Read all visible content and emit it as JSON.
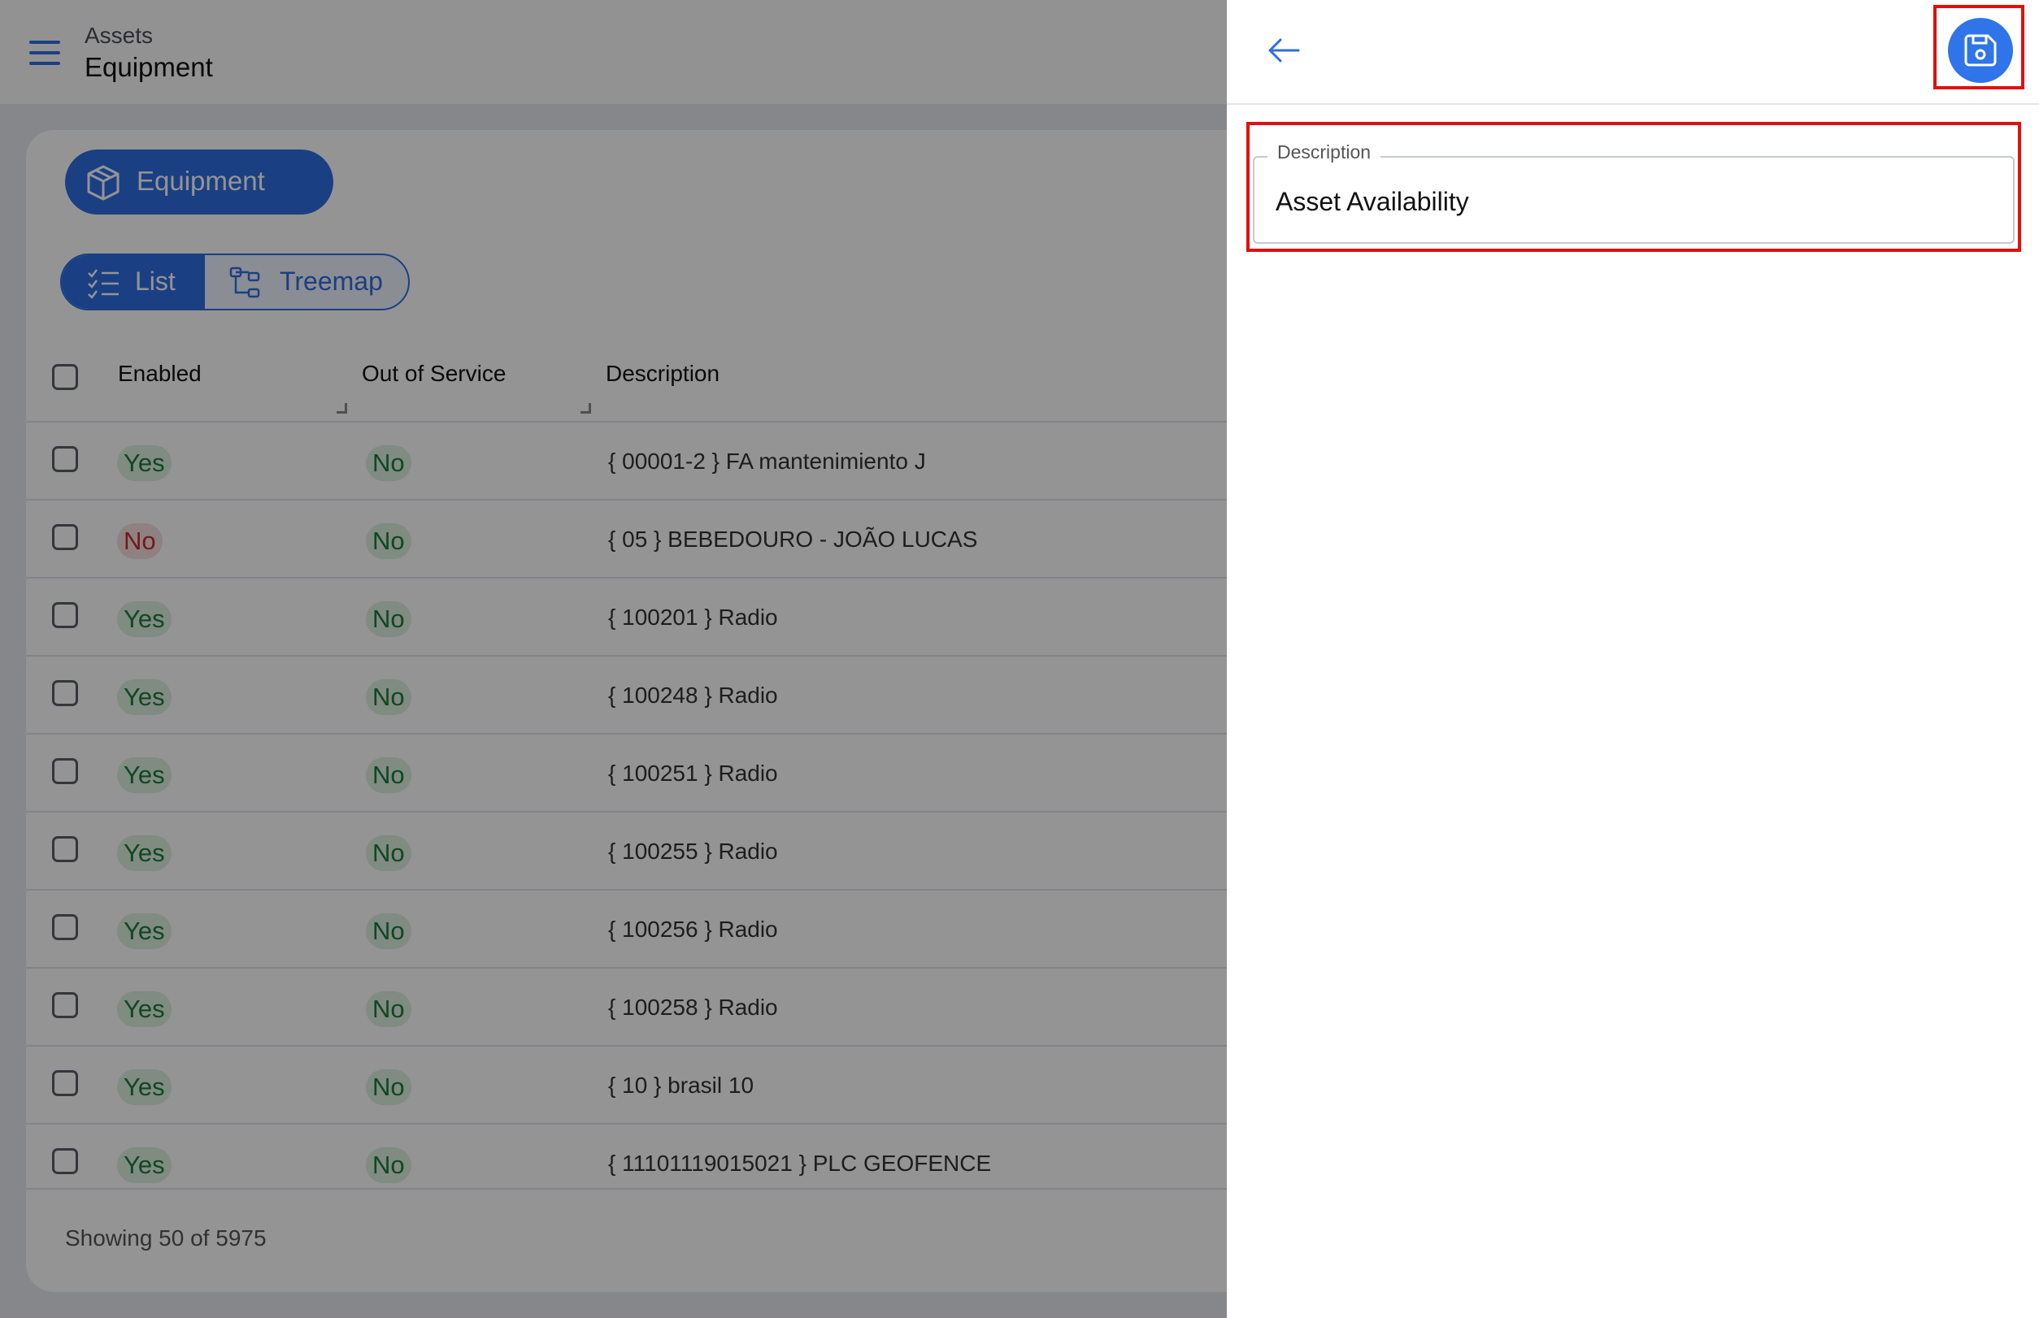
{
  "header": {
    "breadcrumb_parent": "Assets",
    "title": "Equipment"
  },
  "type_selector": {
    "label": "Equipment"
  },
  "view_toggle": {
    "list_label": "List",
    "treemap_label": "Treemap"
  },
  "table": {
    "columns": [
      "Enabled",
      "Out of Service",
      "Description"
    ],
    "rows": [
      {
        "enabled": "Yes",
        "out_of_service": "No",
        "description": "{ 00001-2 } FA mantenimiento J"
      },
      {
        "enabled": "No",
        "out_of_service": "No",
        "description": "{ 05 } BEBEDOURO - JOÃO LUCAS"
      },
      {
        "enabled": "Yes",
        "out_of_service": "No",
        "description": "{ 100201 } Radio"
      },
      {
        "enabled": "Yes",
        "out_of_service": "No",
        "description": "{ 100248 } Radio"
      },
      {
        "enabled": "Yes",
        "out_of_service": "No",
        "description": "{ 100251 } Radio"
      },
      {
        "enabled": "Yes",
        "out_of_service": "No",
        "description": "{ 100255 } Radio"
      },
      {
        "enabled": "Yes",
        "out_of_service": "No",
        "description": "{ 100256 } Radio"
      },
      {
        "enabled": "Yes",
        "out_of_service": "No",
        "description": "{ 100258 } Radio"
      },
      {
        "enabled": "Yes",
        "out_of_service": "No",
        "description": "{ 10 } brasil 10"
      },
      {
        "enabled": "Yes",
        "out_of_service": "No",
        "description": "{ 11101119015021 } PLC GEOFENCE"
      }
    ],
    "footer": "Showing 50 of 5975"
  },
  "panel": {
    "description_field": {
      "label": "Description",
      "value": "Asset Availability"
    }
  },
  "colors": {
    "accent": "#2f6de2",
    "highlight": "#e01010",
    "yes": "#1c7a3a",
    "no_disabled": "#c42b2b"
  }
}
